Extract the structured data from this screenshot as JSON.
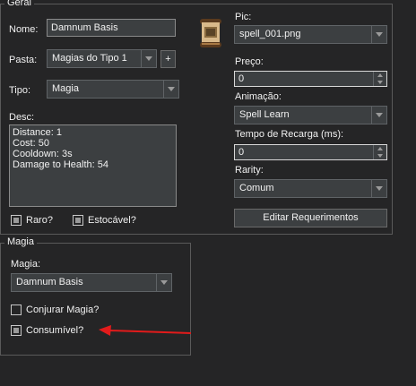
{
  "geral": {
    "title": "Geral",
    "nome_label": "Nome:",
    "nome_value": "Damnum Basis",
    "pasta_label": "Pasta:",
    "pasta_value": "Magias do Tipo 1",
    "pasta_add": "+",
    "tipo_label": "Tipo:",
    "tipo_value": "Magia",
    "desc_label": "Desc:",
    "desc_lines": [
      "Distance: 1",
      "Cost: 50",
      "Cooldown: 3s",
      "Damage to Health: 54"
    ],
    "raro_label": "Raro?",
    "estocavel_label": "Estocável?",
    "pic_label": "Pic:",
    "pic_value": "spell_001.png",
    "preco_label": "Preço:",
    "preco_value": "0",
    "animacao_label": "Animação:",
    "animacao_value": "Spell Learn",
    "recarga_label": "Tempo de Recarga (ms):",
    "recarga_value": "0",
    "rarity_label": "Rarity:",
    "rarity_value": "Comum",
    "req_button": "Editar Requerimentos"
  },
  "magia": {
    "title": "Magia",
    "magia_label": "Magia:",
    "magia_value": "Damnum Basis",
    "conjurar_label": "Conjurar Magia?",
    "consumivel_label": "Consumível?"
  },
  "icons": {
    "pic_icon": "scroll-icon",
    "annotation": "red-arrow-icon"
  },
  "colors": {
    "background": "#252526",
    "field": "#3c3f41",
    "annotation": "#e21b1b"
  }
}
